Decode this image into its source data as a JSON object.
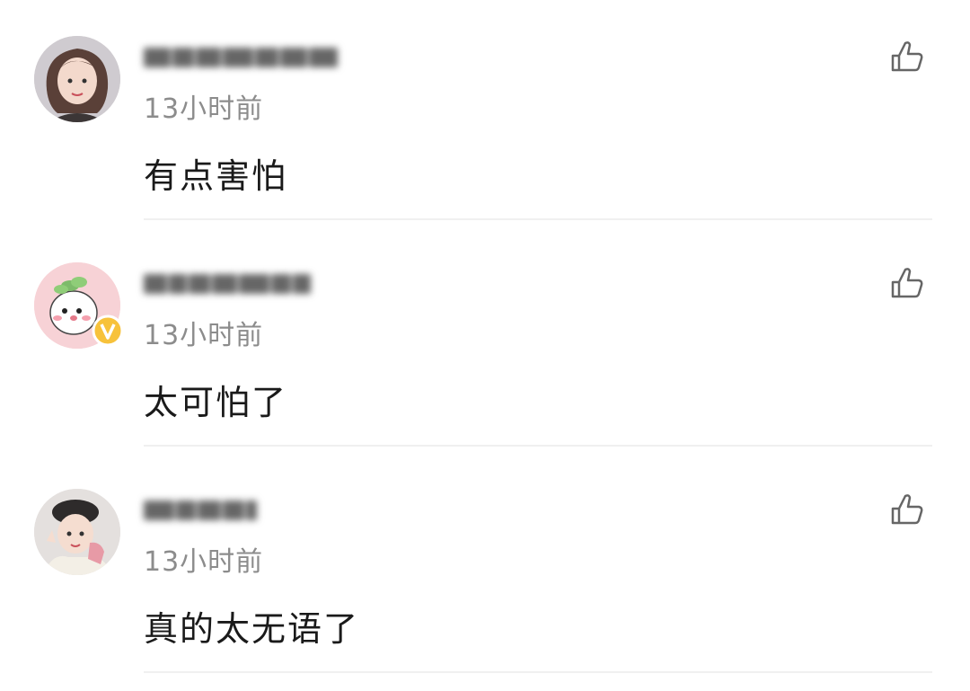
{
  "comments": [
    {
      "time": "13小时前",
      "text": "有点害怕",
      "avatar": "avatar-woman-short-hair",
      "verified": false,
      "like_icon": "thumbs-up-icon"
    },
    {
      "time": "13小时前",
      "text": "太可怕了",
      "avatar": "avatar-cartoon-character",
      "verified": true,
      "like_icon": "thumbs-up-icon"
    },
    {
      "time": "13小时前",
      "text": "真的太无语了",
      "avatar": "avatar-child-with-hat",
      "verified": false,
      "like_icon": "thumbs-up-icon"
    }
  ],
  "colors": {
    "text": "#1a1a1a",
    "time": "#8c8c8c",
    "divider": "#f0f0f0",
    "verified_badge": "#f7c23b"
  }
}
